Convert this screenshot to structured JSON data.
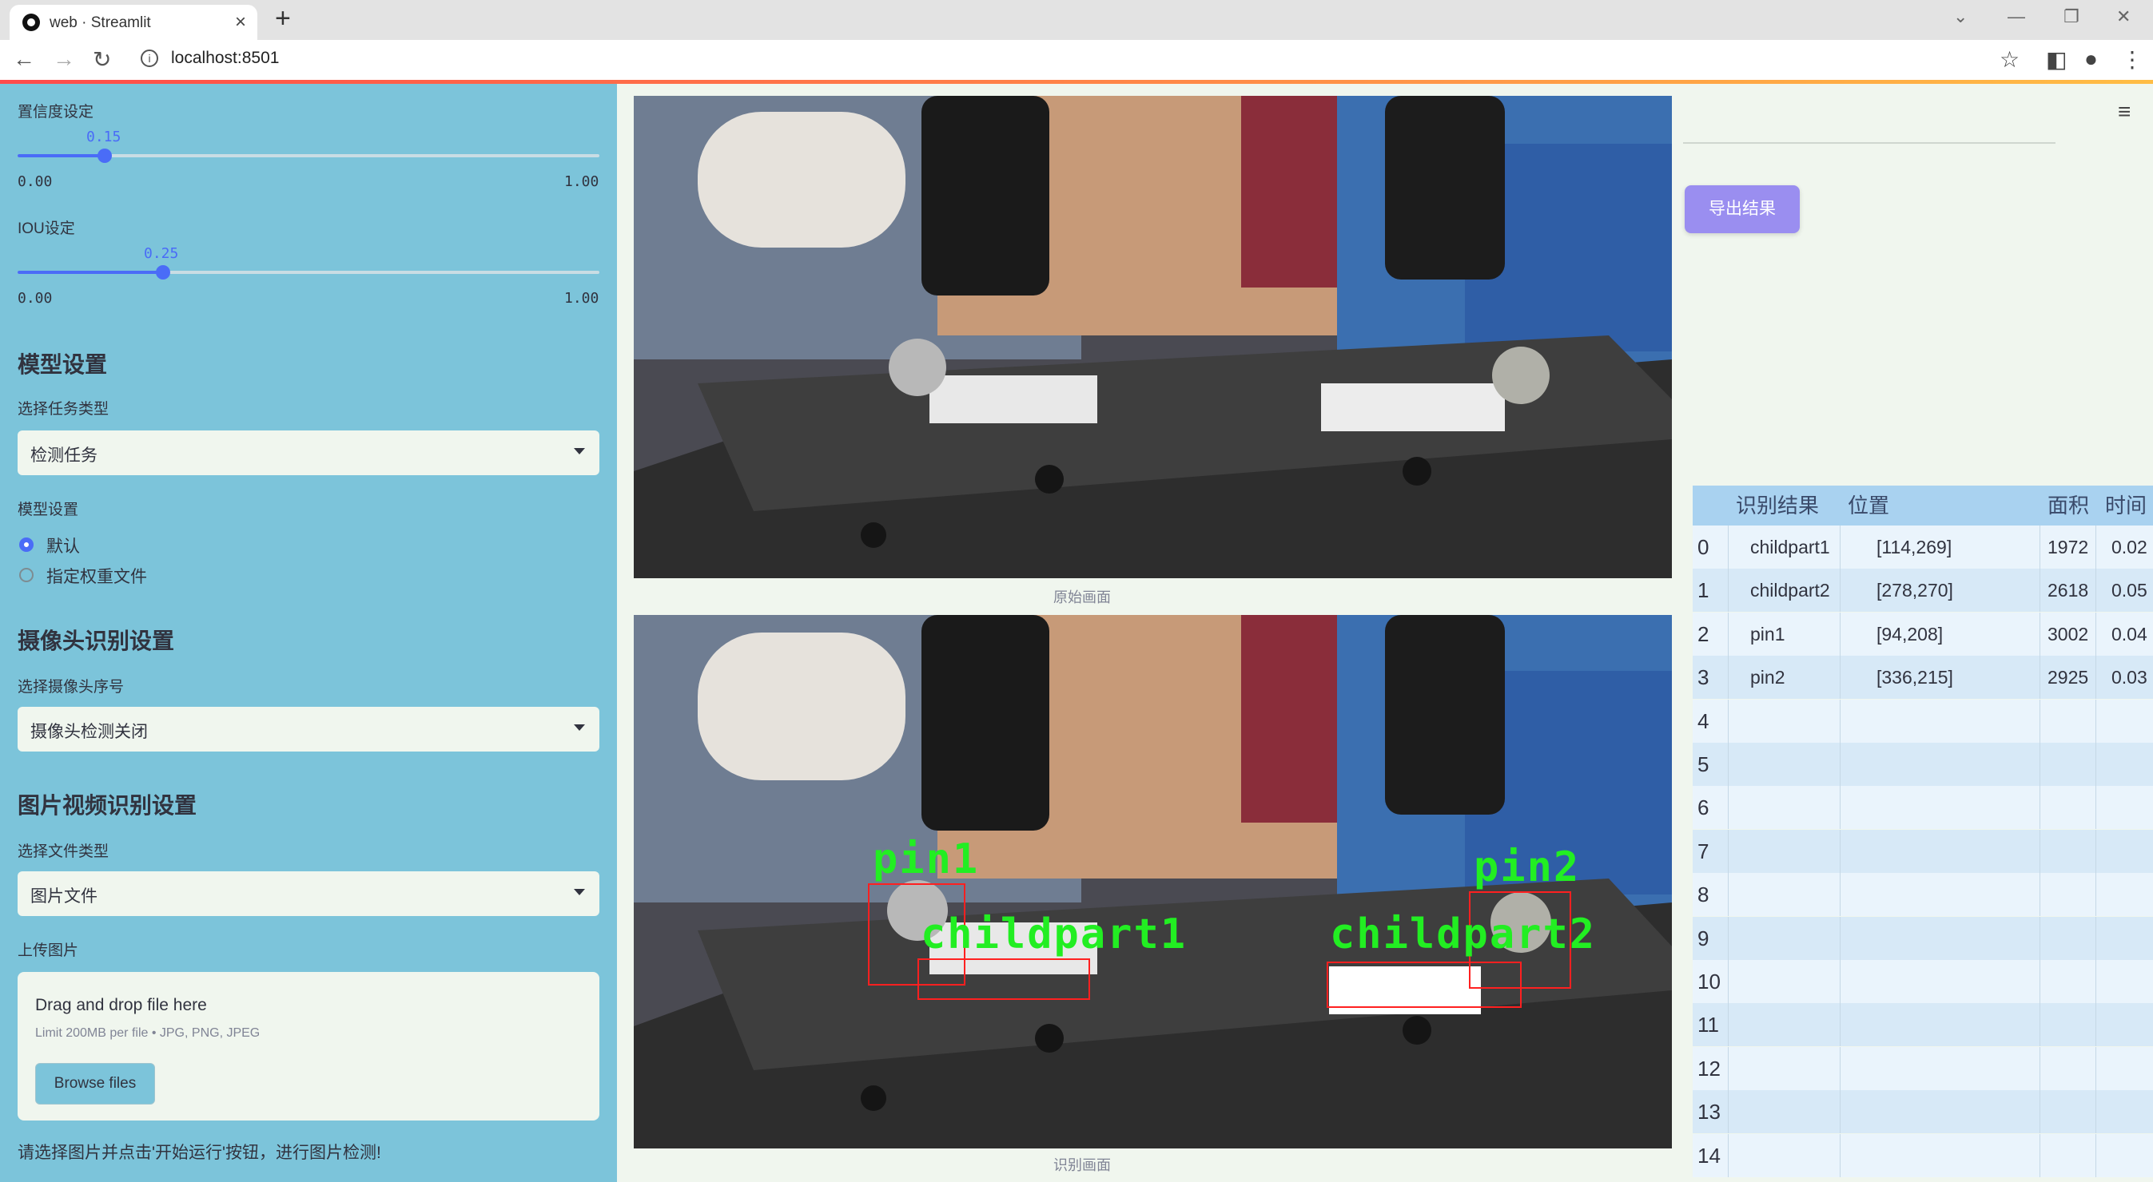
{
  "browser": {
    "tab_title": "web · Streamlit",
    "url": "localhost:8501"
  },
  "sidebar": {
    "conf_label": "置信度设定",
    "conf_value": "0.15",
    "conf_min": "0.00",
    "conf_max": "1.00",
    "conf_fraction": 0.15,
    "iou_label": "IOU设定",
    "iou_value": "0.25",
    "iou_min": "0.00",
    "iou_max": "1.00",
    "iou_fraction": 0.25,
    "model_header": "模型设置",
    "task_type_label": "选择任务类型",
    "task_type_value": "检测任务",
    "model_label": "模型设置",
    "model_options": [
      "默认",
      "指定权重文件"
    ],
    "model_selected": "默认",
    "camera_header": "摄像头识别设置",
    "camera_label": "选择摄像头序号",
    "camera_value": "摄像头检测关闭",
    "media_header": "图片视频识别设置",
    "file_type_label": "选择文件类型",
    "file_type_value": "图片文件",
    "upload_label": "上传图片",
    "upload_title": "Drag and drop file here",
    "upload_limit": "Limit 200MB per file • JPG, PNG, JPEG",
    "browse_label": "Browse files",
    "hint": "请选择图片并点击'开始运行'按钮，进行图片检测!"
  },
  "main": {
    "original_caption": "原始画面",
    "result_caption": "识别画面",
    "export_label": "导出结果",
    "detections": [
      {
        "label": "pin1"
      },
      {
        "label": "pin2"
      },
      {
        "label": "childpart1"
      },
      {
        "label": "childpart2"
      }
    ]
  },
  "table": {
    "headers": [
      "识别结果",
      "位置",
      "面积",
      "时间"
    ],
    "rows": [
      {
        "idx": "0",
        "name": "childpart1",
        "pos": "[114,269]",
        "area": "1972",
        "time": "0.02"
      },
      {
        "idx": "1",
        "name": "childpart2",
        "pos": "[278,270]",
        "area": "2618",
        "time": "0.05"
      },
      {
        "idx": "2",
        "name": "pin1",
        "pos": "[94,208]",
        "area": "3002",
        "time": "0.04"
      },
      {
        "idx": "3",
        "name": "pin2",
        "pos": "[336,215]",
        "area": "2925",
        "time": "0.03"
      },
      {
        "idx": "4",
        "name": "",
        "pos": "",
        "area": "",
        "time": ""
      },
      {
        "idx": "5",
        "name": "",
        "pos": "",
        "area": "",
        "time": ""
      },
      {
        "idx": "6",
        "name": "",
        "pos": "",
        "area": "",
        "time": ""
      },
      {
        "idx": "7",
        "name": "",
        "pos": "",
        "area": "",
        "time": ""
      },
      {
        "idx": "8",
        "name": "",
        "pos": "",
        "area": "",
        "time": ""
      },
      {
        "idx": "9",
        "name": "",
        "pos": "",
        "area": "",
        "time": ""
      },
      {
        "idx": "10",
        "name": "",
        "pos": "",
        "area": "",
        "time": ""
      },
      {
        "idx": "11",
        "name": "",
        "pos": "",
        "area": "",
        "time": ""
      },
      {
        "idx": "12",
        "name": "",
        "pos": "",
        "area": "",
        "time": ""
      },
      {
        "idx": "13",
        "name": "",
        "pos": "",
        "area": "",
        "time": ""
      },
      {
        "idx": "14",
        "name": "",
        "pos": "",
        "area": "",
        "time": ""
      }
    ]
  }
}
